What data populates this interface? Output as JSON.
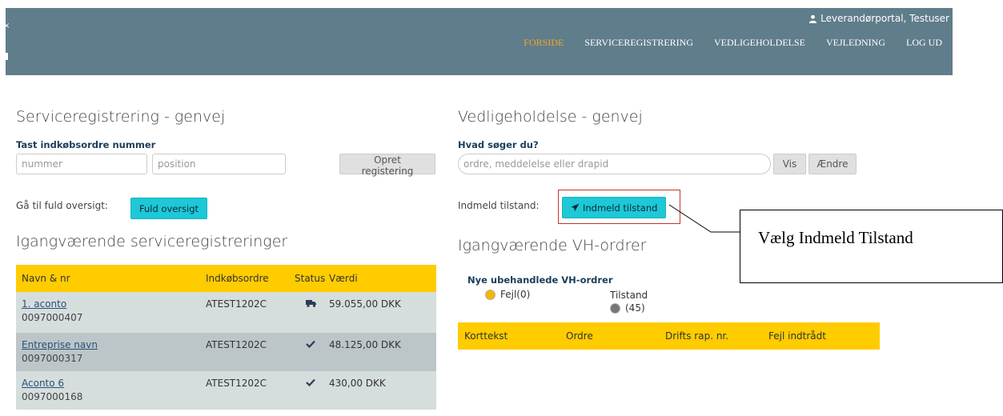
{
  "header": {
    "user_label": "Leverandørportal, Testuser",
    "nav": [
      {
        "label": "FORSIDE",
        "active": true
      },
      {
        "label": "SERVICEREGISTRERING",
        "active": false
      },
      {
        "label": "VEDLIGEHOLDELSE",
        "active": false
      },
      {
        "label": "VEJLEDNING",
        "active": false
      },
      {
        "label": "LOG UD",
        "active": false
      }
    ],
    "edge_glyph": "×"
  },
  "service": {
    "title": "Serviceregistrering - genvej",
    "po_label": "Tast indkøbsordre nummer",
    "number_placeholder": "nummer",
    "position_placeholder": "position",
    "create_button": "Opret registering",
    "overview_label": "Gå til fuld oversigt:",
    "overview_button": "Fuld oversigt"
  },
  "ongoing_service": {
    "title": "Igangværende serviceregistreringer",
    "columns": [
      "Navn & nr",
      "Indkøbsordre",
      "Status",
      "Værdi"
    ],
    "rows": [
      {
        "name": "1. aconto",
        "number": "0097000407",
        "order": "ATEST1202C",
        "status_icon": "truck-icon",
        "value": "59.055,00 DKK"
      },
      {
        "name": "Entreprise navn",
        "number": "0097000317",
        "order": "ATEST1202C",
        "status_icon": "check-icon",
        "value": "48.125,00 DKK"
      },
      {
        "name": "Aconto 6",
        "number": "0097000168",
        "order": "ATEST1202C",
        "status_icon": "check-icon",
        "value": "430,00 DKK"
      }
    ]
  },
  "maintenance": {
    "title": "Vedligeholdelse - genvej",
    "search_label": "Hvad søger du?",
    "search_placeholder": "ordre, meddelelse eller drapid",
    "view_button": "Vis",
    "change_button": "Ændre",
    "report_label": "Indmeld tilstand:",
    "report_button": "Indmeld tilstand"
  },
  "ongoing_vh": {
    "title": "Igangværende VH-ordrer",
    "new_label": "Nye ubehandlede VH-ordrer",
    "options": [
      {
        "label": "Fejl(0)",
        "color": "#f5b800"
      },
      {
        "label_line1": "Tilstand",
        "label_line2": "(45)",
        "color": "#777777"
      }
    ],
    "columns": [
      "Korttekst",
      "Ordre",
      "Drifts rap. nr.",
      "Fejl indtrådt"
    ]
  },
  "callout": {
    "text": "Vælg Indmeld Tilstand"
  },
  "colors": {
    "topbar": "#607d8b",
    "accent_yellow": "#ffcc00",
    "button_cyan": "#1ec8d6",
    "active_nav": "#f5a623",
    "highlight": "#c0392b"
  }
}
